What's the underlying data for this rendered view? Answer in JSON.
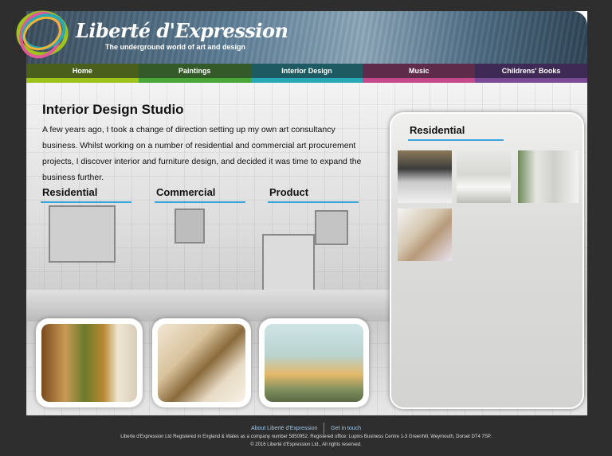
{
  "brand": {
    "name": "Liberté d'Expression",
    "tagline": "The underground world of art and design"
  },
  "nav": [
    {
      "label": "Home",
      "color": "#9ec31a"
    },
    {
      "label": "Paintings",
      "color": "#4aa83a"
    },
    {
      "label": "Interior Design",
      "color": "#27a9b6"
    },
    {
      "label": "Music",
      "color": "#c4498a"
    },
    {
      "label": "Childrens' Books",
      "color": "#7a4a96"
    }
  ],
  "page": {
    "title": "Interior Design  Studio",
    "intro": "A few years ago, I took a change of direction setting up my own art consultancy business. Whilst working on a number of residential and commercial art procurement projects, I discover interior and furniture design, and decided it was time to expand the business further."
  },
  "categories": [
    {
      "label": "Residential"
    },
    {
      "label": "Commercial"
    },
    {
      "label": "Product"
    }
  ],
  "gallery": {
    "title": "Residential"
  },
  "footer": {
    "link_about": "About Liberté d'Expression",
    "link_contact": "Get in touch",
    "registration": "Liberte d'Expression Ltd Registered in England & Wales as a company number 5850952. Registered office: Lupins Business Centre 1-3 Greenhill, Weymouth, Dorset DT4 7SP.",
    "copyright": "© 2016 Liberté d'Expression Ltd., All rights reserved."
  },
  "colors": {
    "accent_underline": "#3aa6dc",
    "background": "#2e2e2e"
  }
}
